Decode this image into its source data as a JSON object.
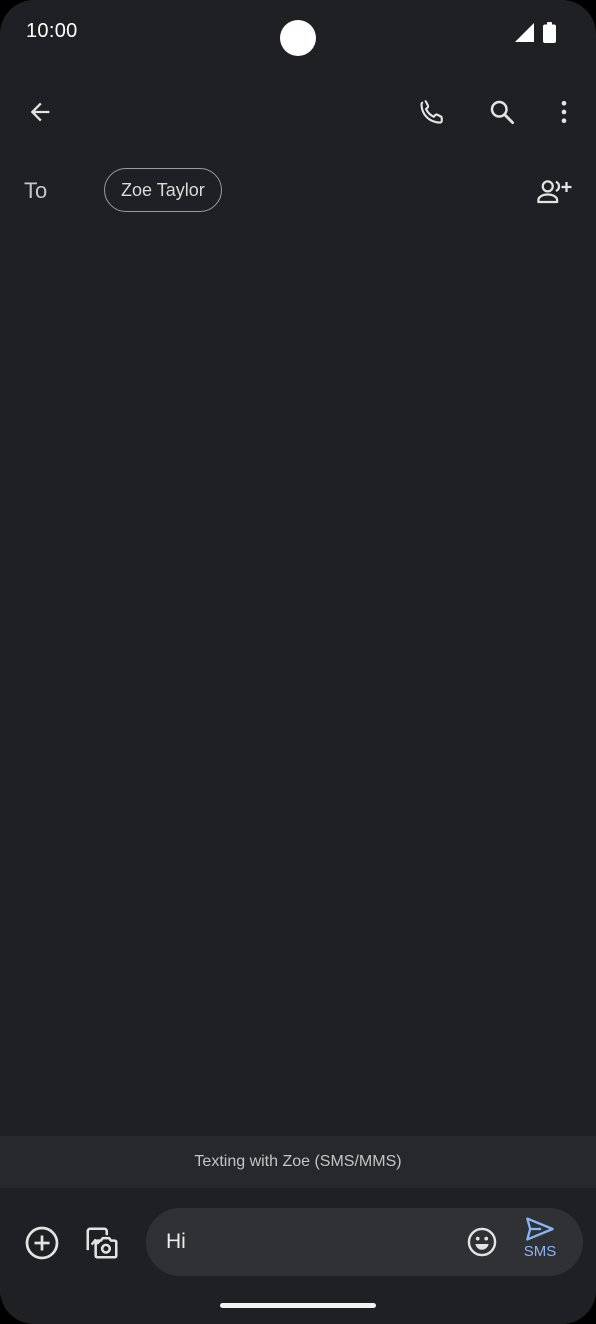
{
  "status_bar": {
    "time": "10:00",
    "icons": [
      "signal-icon",
      "battery-icon"
    ]
  },
  "app_bar": {
    "icons": {
      "back": "arrow-back-icon",
      "call": "phone-icon",
      "search": "search-icon",
      "more": "more-vert-icon"
    }
  },
  "recipients": {
    "to_label": "To",
    "chip_name": "Zoe Taylor",
    "add_icon": "add-person-icon"
  },
  "banner": {
    "text": "Texting with Zoe (SMS/MMS)"
  },
  "compose": {
    "message_value": "Hi",
    "send_label": "SMS",
    "icons": {
      "add": "add-circle-icon",
      "gallery": "gallery-camera-icon",
      "emoji": "emoji-icon",
      "send": "send-icon"
    }
  },
  "colors": {
    "background": "#1f2023",
    "accent": "#8ab4f8",
    "field": "#303134",
    "banner": "#26282c"
  }
}
